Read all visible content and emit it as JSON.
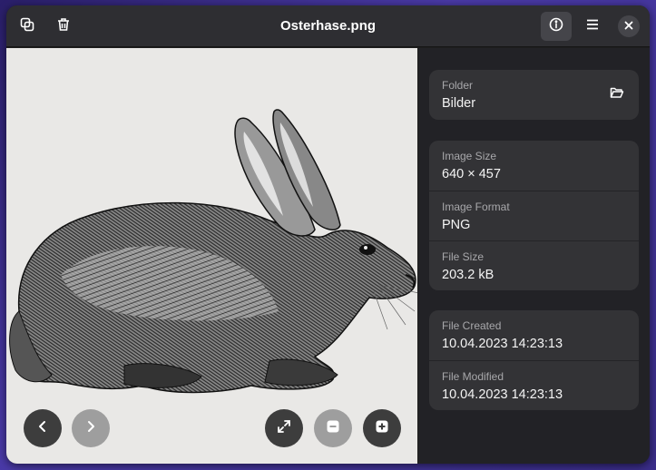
{
  "header": {
    "title": "Osterhase.png",
    "buttons": [
      "copy-icon",
      "trash-icon",
      "info-icon",
      "menu-icon",
      "close-icon"
    ]
  },
  "viewer": {
    "controls": [
      "chevron-left-icon",
      "chevron-right-icon",
      "fullscreen-icon",
      "zoom-out-icon",
      "zoom-in-icon"
    ]
  },
  "sidebar": {
    "folder": {
      "label": "Folder",
      "value": "Bilder"
    },
    "image_size": {
      "label": "Image Size",
      "value": "640 × 457"
    },
    "image_format": {
      "label": "Image Format",
      "value": "PNG"
    },
    "file_size": {
      "label": "File Size",
      "value": "203.2 kB"
    },
    "file_created": {
      "label": "File Created",
      "value": "10.04.2023 14:23:13"
    },
    "file_modified": {
      "label": "File Modified",
      "value": "10.04.2023 14:23:13"
    }
  },
  "colors": {
    "window_bg": "#1e1e1e",
    "headerbar_bg": "#2e2e32",
    "card_bg": "#333336",
    "viewer_bg": "#e9e8e6"
  }
}
